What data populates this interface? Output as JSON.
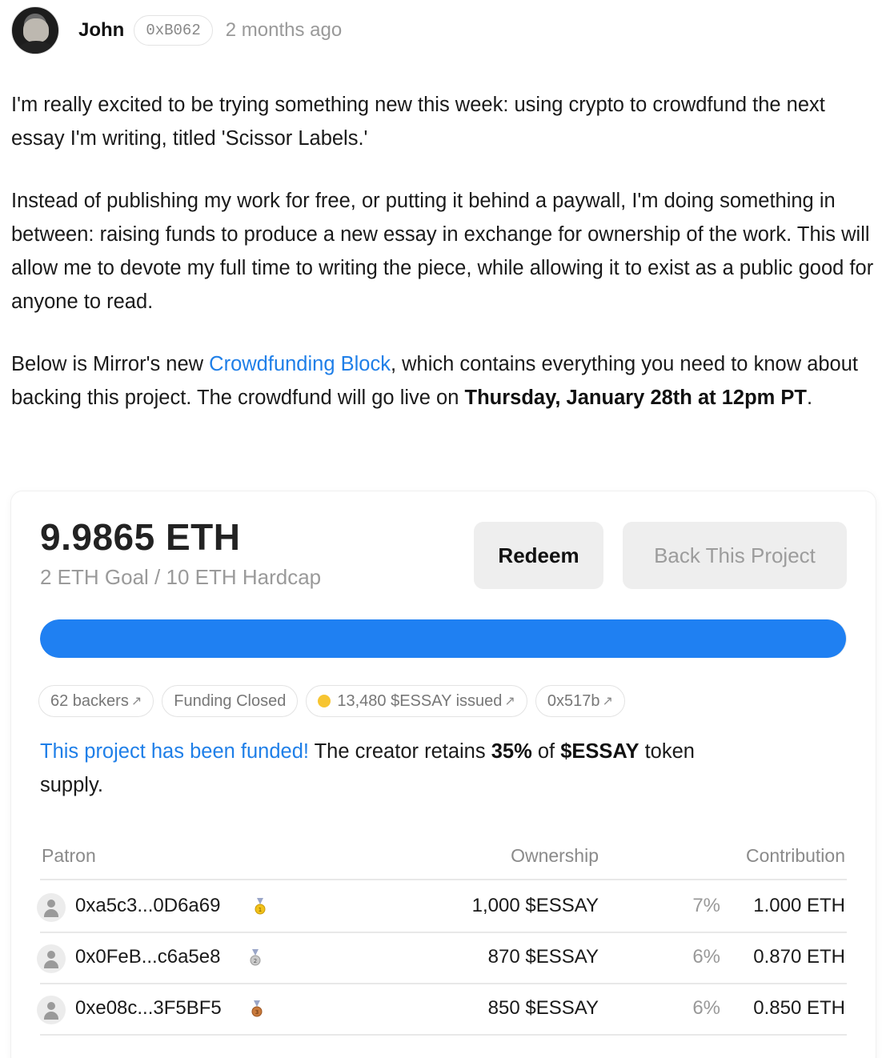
{
  "author": {
    "name": "John",
    "address": "0xB062",
    "time_ago": "2 months ago"
  },
  "post": {
    "p1": "I'm really excited to be trying something new this week: using crypto to crowdfund the next essay I'm writing, titled 'Scissor Labels.'",
    "p2": "Instead of publishing my work for free, or putting it behind a paywall, I'm doing something in between: raising funds to produce a new essay in exchange for ownership of the work. This will allow me to devote my full time to writing the piece, while allowing it to exist as a public good for anyone to read.",
    "p3_before": "Below is Mirror's new ",
    "p3_link": "Crowdfunding Block",
    "p3_middle": ", which contains everything you need to know about backing this project. The crowdfund will go live on ",
    "p3_bold": "Thursday, January 28th at 12pm PT",
    "p3_end": "."
  },
  "crowdfund": {
    "raised": "9.9865 ETH",
    "goal_text": "2 ETH Goal / 10 ETH Hardcap",
    "redeem_label": "Redeem",
    "back_label": "Back This Project",
    "progress_fraction": 0.99865,
    "accent_color": "#1f80f2",
    "chips": {
      "backers": "62 backers",
      "status": "Funding Closed",
      "issued": "13,480 $ESSAY issued",
      "contract": "0x517b"
    },
    "funded_highlight": "This project has been funded!",
    "funded_text_1": " The creator retains ",
    "funded_pct": "35%",
    "funded_text_2": " of ",
    "funded_token": "$ESSAY",
    "funded_text_3": " token supply.",
    "table": {
      "col_patron": "Patron",
      "col_ownership": "Ownership",
      "col_contribution": "Contribution",
      "rows": [
        {
          "address": "0xa5c3...0D6a69",
          "medal": "gold-medal-icon",
          "ownership": "1,000 $ESSAY",
          "pct": "7%",
          "contribution": "1.000 ETH"
        },
        {
          "address": "0x0FeB...c6a5e8",
          "medal": "silver-medal-icon",
          "ownership": "870 $ESSAY",
          "pct": "6%",
          "contribution": "0.870 ETH"
        },
        {
          "address": "0xe08c...3F5BF5",
          "medal": "bronze-medal-icon",
          "ownership": "850 $ESSAY",
          "pct": "6%",
          "contribution": "0.850 ETH"
        }
      ]
    }
  }
}
